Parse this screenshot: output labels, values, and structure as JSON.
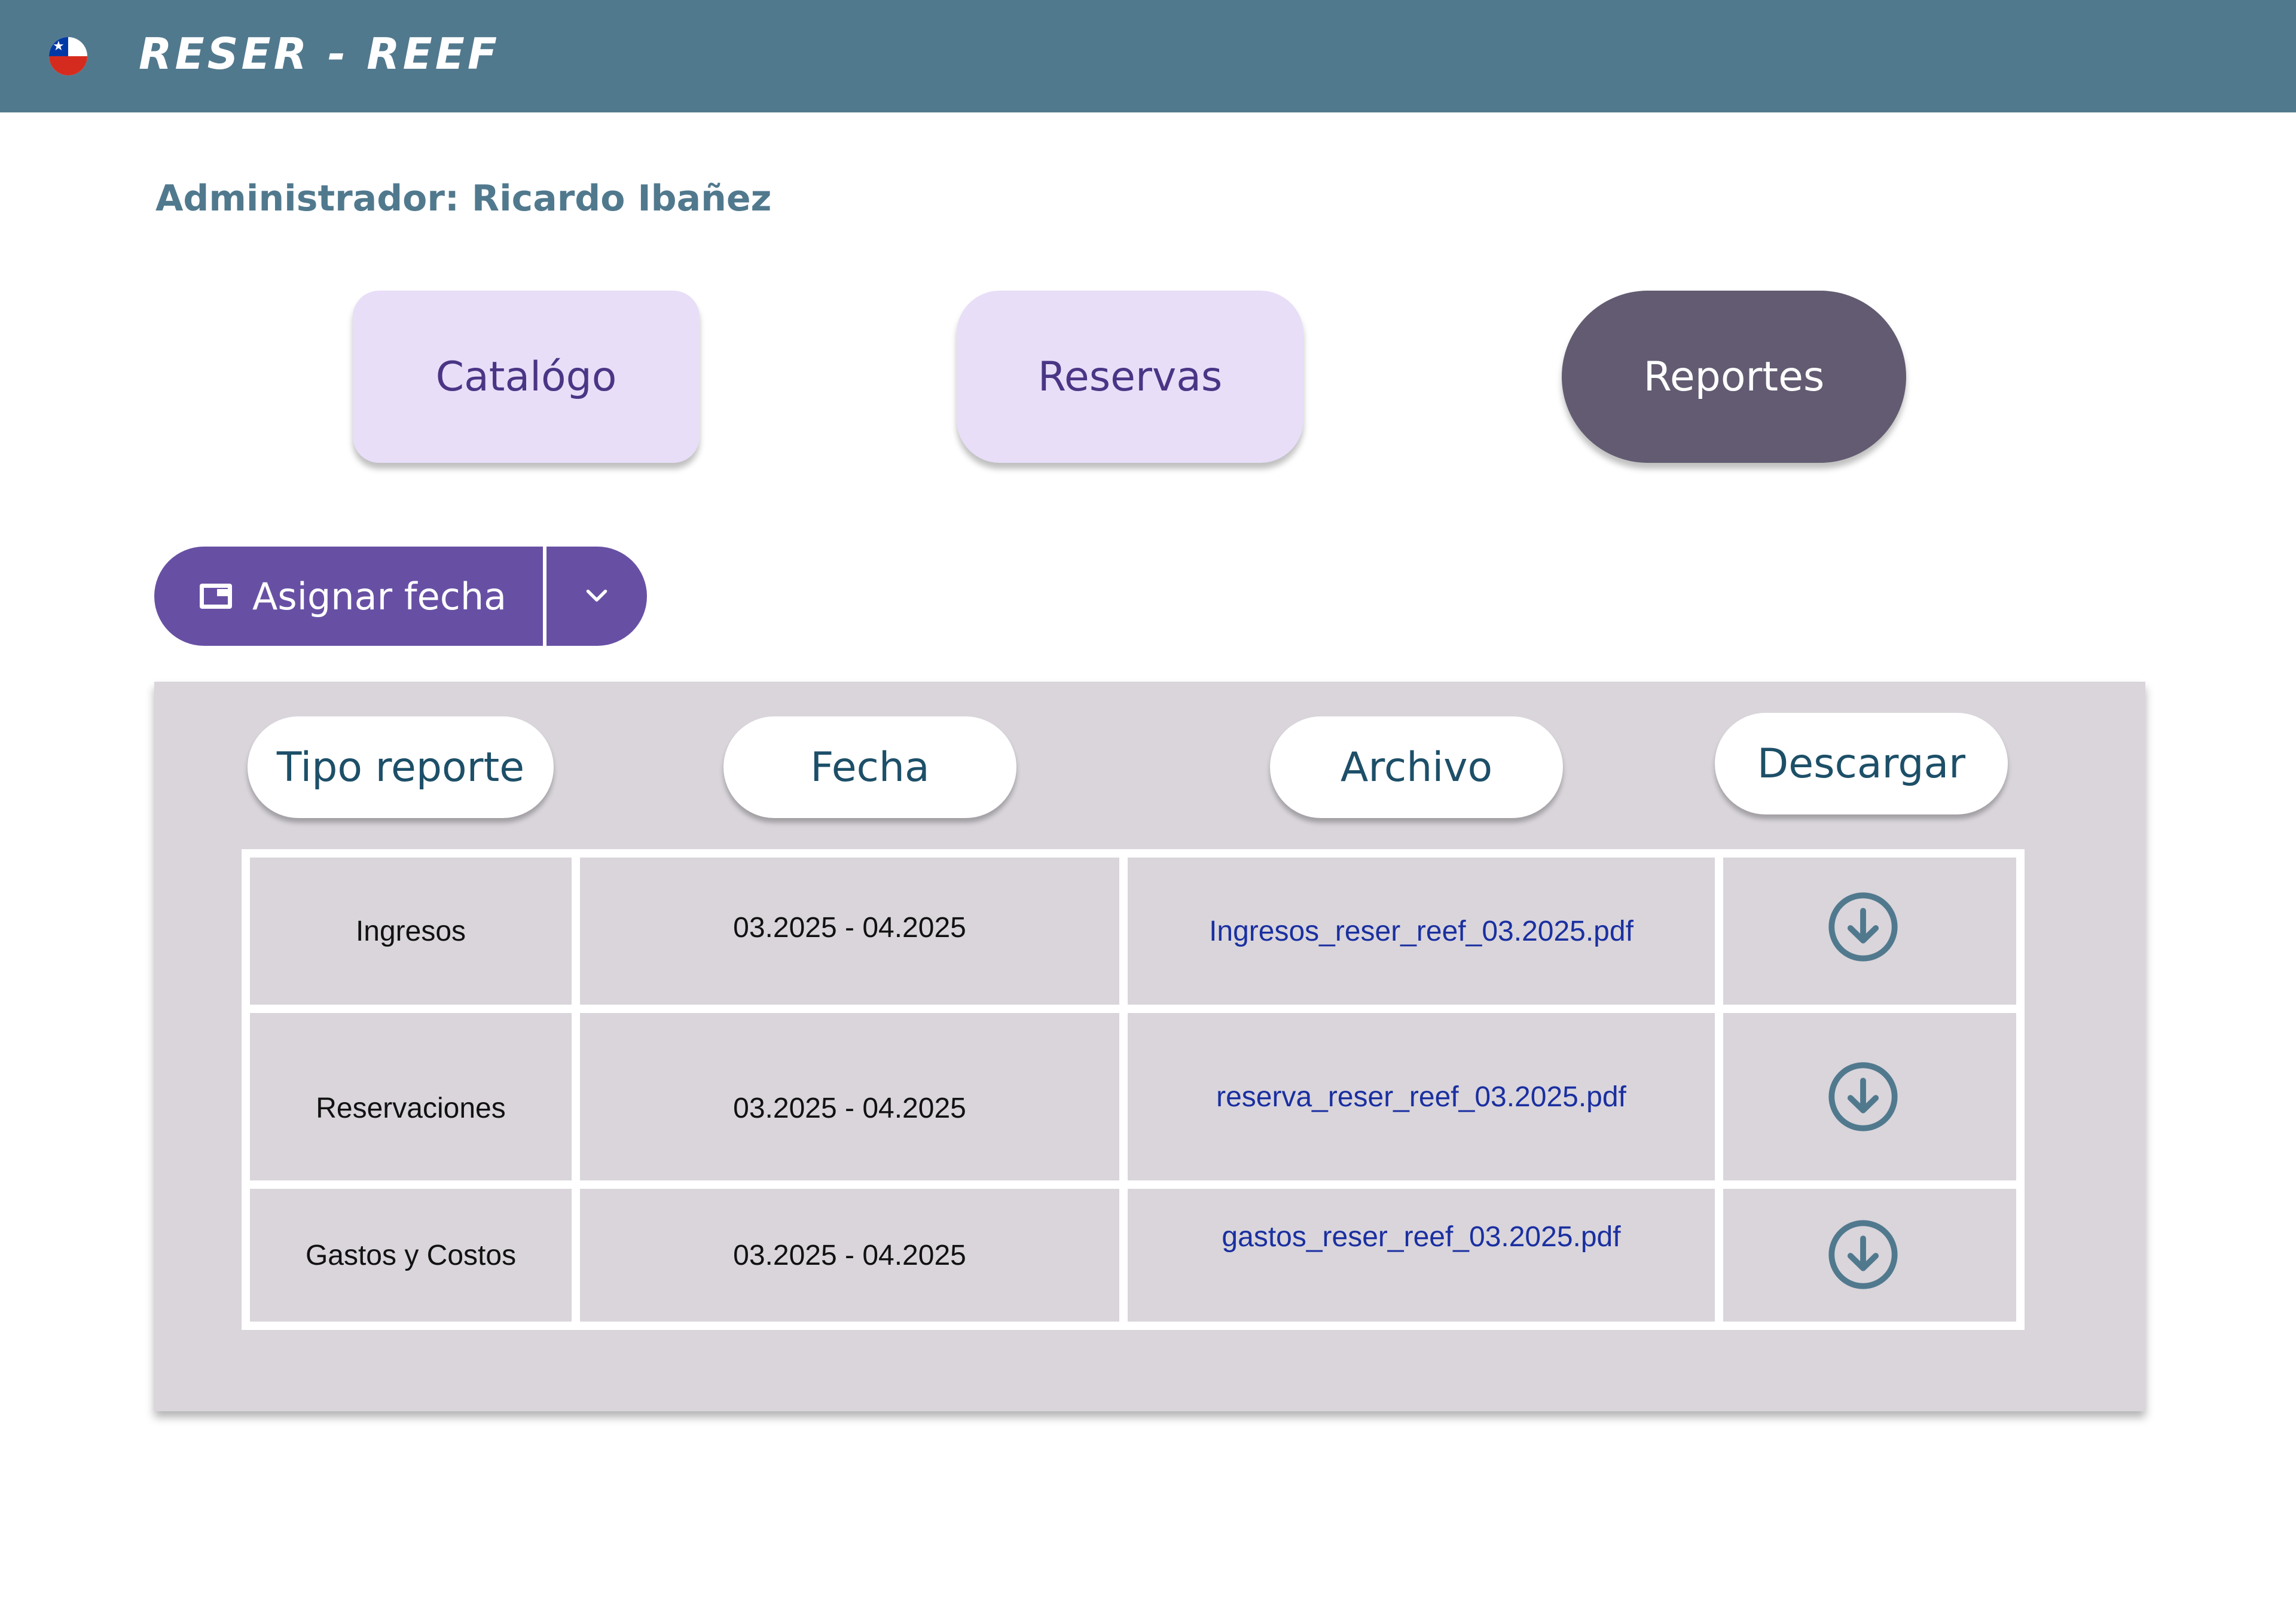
{
  "header": {
    "brand": "RESER - REEF",
    "flag_icon": "chile-flag-icon",
    "background": "#51798e"
  },
  "admin": {
    "label": "Administrador: Ricardo Ibañez"
  },
  "nav": {
    "items": [
      {
        "label": "Catalógo",
        "active": false
      },
      {
        "label": "Reservas",
        "active": false
      },
      {
        "label": "Reportes",
        "active": true
      }
    ]
  },
  "date_button": {
    "label": "Asignar fecha",
    "icon": "calendar-icon",
    "arrow_icon": "chevron-down-icon",
    "color": "#6750a4"
  },
  "table": {
    "headers": [
      "Tipo reporte",
      "Fecha",
      "Archivo",
      "Descargar"
    ],
    "rows": [
      {
        "tipo": "Ingresos",
        "fecha": "03.2025 - 04.2025",
        "archivo": "Ingresos_reser_reef_03.2025.pdf",
        "icon": "download-icon"
      },
      {
        "tipo": "Reservaciones",
        "fecha": "03.2025 - 04.2025",
        "archivo": "reserva_reser_reef_03.2025.pdf",
        "icon": "download-icon"
      },
      {
        "tipo": "Gastos y Costos",
        "fecha": "03.2025 - 04.2025",
        "archivo": "gastos_reser_reef_03.2025.pdf",
        "icon": "download-icon"
      }
    ]
  }
}
